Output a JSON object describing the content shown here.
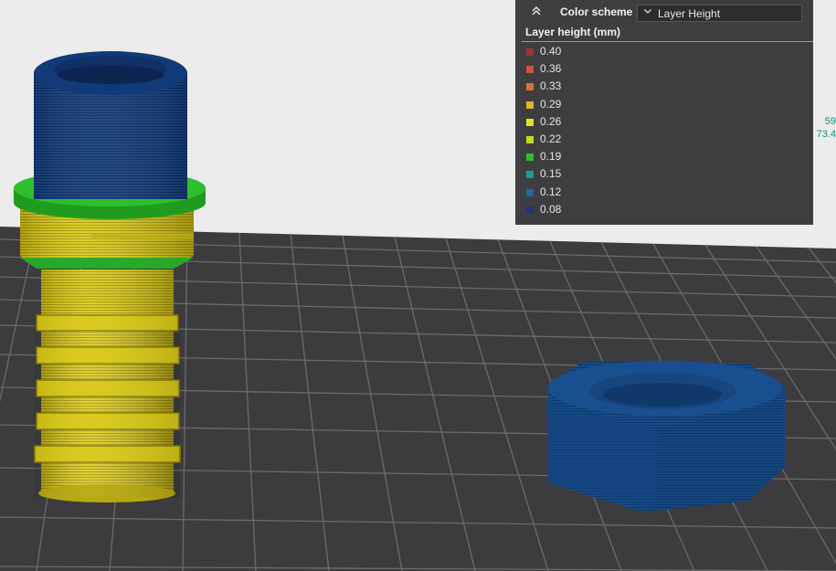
{
  "toolbar": {
    "collapse_icon": "chevrons-up-icon",
    "color_scheme_label": "Color scheme",
    "color_scheme_value": "Layer Height",
    "dropdown_icon": "chevron-down-icon"
  },
  "legend": {
    "title": "Layer height (mm)",
    "items": [
      {
        "label": "0.40",
        "color": "#a5322b"
      },
      {
        "label": "0.36",
        "color": "#c9573f"
      },
      {
        "label": "0.33",
        "color": "#d27334"
      },
      {
        "label": "0.29",
        "color": "#e0b42b"
      },
      {
        "label": "0.26",
        "color": "#ecdf1e"
      },
      {
        "label": "0.22",
        "color": "#b9e023"
      },
      {
        "label": "0.19",
        "color": "#2fbd2a"
      },
      {
        "label": "0.15",
        "color": "#1f9a93"
      },
      {
        "label": "0.12",
        "color": "#1f6aa0"
      },
      {
        "label": "0.08",
        "color": "#16397d"
      }
    ]
  },
  "readout": {
    "line1": "59",
    "line2": "73.4"
  },
  "colors": {
    "background": "#ececec",
    "bed": "#3c3c3e",
    "grid": "#6a6a6a",
    "layer_blue": "#123a7a",
    "layer_green": "#21a621",
    "layer_yellow": "#d6c514",
    "nut_blue": "#14478a",
    "accent_teal": "#0e8d8d"
  }
}
